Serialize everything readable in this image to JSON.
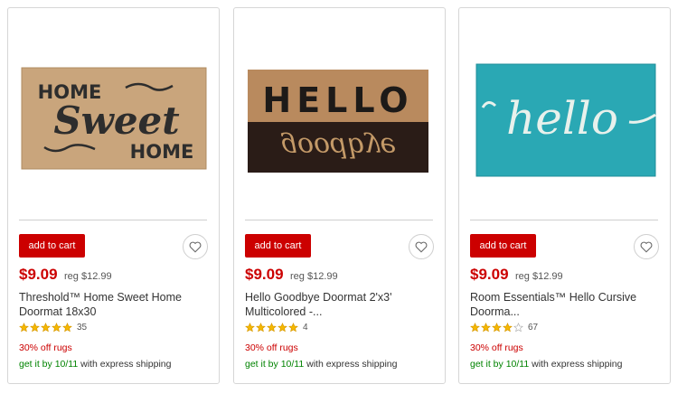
{
  "products": [
    {
      "image_label": "doormat-home-sweet-home",
      "add_to_cart": "add to cart",
      "price": "$9.09",
      "reg_price": "reg $12.99",
      "title_line1": "Threshold™ Home Sweet Home",
      "title_line2": "Doormat 18x30",
      "rating": 5,
      "review_count": "35",
      "promo": "30% off rugs",
      "ship_prefix": "get it by 10/11",
      "ship_suffix": " with express shipping",
      "mat_text": [
        "HOME",
        "Sweet",
        "HOME"
      ]
    },
    {
      "image_label": "doormat-hello-goodbye",
      "add_to_cart": "add to cart",
      "price": "$9.09",
      "reg_price": "reg $12.99",
      "title_line1": "Hello Goodbye Doormat 2'x3'",
      "title_line2": "Multicolored -...",
      "rating": 5,
      "review_count": "4",
      "promo": "30% off rugs",
      "ship_prefix": "get it by 10/11",
      "ship_suffix": " with express shipping",
      "mat_text": [
        "HELLO",
        "goodbye"
      ]
    },
    {
      "image_label": "doormat-hello-cursive",
      "add_to_cart": "add to cart",
      "price": "$9.09",
      "reg_price": "reg $12.99",
      "title_line1": "Room Essentials™ Hello Cursive",
      "title_line2": "Doorma...",
      "rating": 4,
      "review_count": "67",
      "promo": "30% off rugs",
      "ship_prefix": "get it by 10/11",
      "ship_suffix": " with express shipping",
      "mat_text": [
        "hello"
      ]
    }
  ],
  "colors": {
    "brand_red": "#cc0000",
    "ship_green": "#008300",
    "star_gold": "#f5b800",
    "coir_tan": "#c8a27a",
    "mat_teal": "#2aa8b4"
  }
}
